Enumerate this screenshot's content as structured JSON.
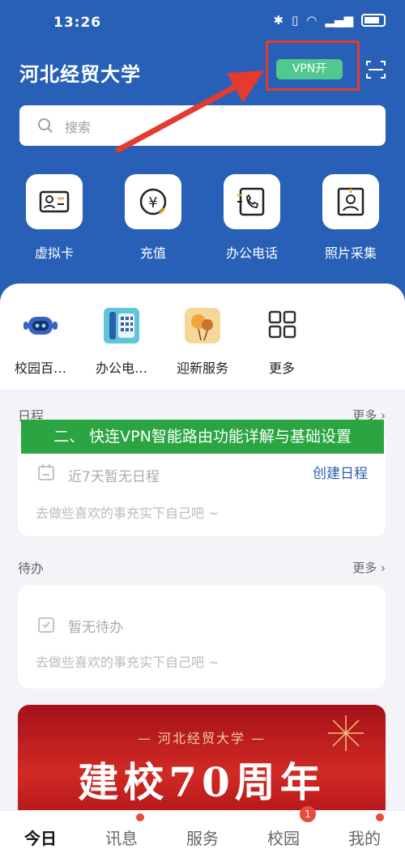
{
  "status_bar": {
    "time": "13:26"
  },
  "header": {
    "title": "河北经贸大学",
    "vpn_label": "VPN开",
    "vpn_color": "#4fc98d",
    "scan_icon": "scan-icon"
  },
  "search": {
    "placeholder": "搜索"
  },
  "quick_actions": [
    {
      "label": "虚拟卡",
      "icon": "id-card-icon"
    },
    {
      "label": "充值",
      "icon": "yen-icon"
    },
    {
      "label": "办公电话",
      "icon": "phone-icon"
    },
    {
      "label": "照片采集",
      "icon": "portrait-icon"
    }
  ],
  "services": [
    {
      "label": "校园百…",
      "icon": "robot-icon"
    },
    {
      "label": "办公电…",
      "icon": "telephone-icon"
    },
    {
      "label": "迎新服务",
      "icon": "balloon-icon"
    },
    {
      "label": "更多",
      "icon": "grid-icon"
    }
  ],
  "schedule": {
    "title": "日程",
    "more": "更多",
    "empty": "近7天暂无日程",
    "tip": "去做些喜欢的事充实下自己吧 ~",
    "create": "创建日程"
  },
  "todo": {
    "title": "待办",
    "more": "更多",
    "empty": "暂无待办",
    "tip": "去做些喜欢的事充实下自己吧 ~"
  },
  "overlay_banner": "二、 快连VPN智能路由功能详解与基础设置",
  "promo": {
    "small": "— 河北经贸大学 —",
    "big": "建校70周年"
  },
  "tabs": [
    {
      "label": "今日",
      "active": true
    },
    {
      "label": "讯息"
    },
    {
      "label": "服务"
    },
    {
      "label": "校园",
      "badge": "1"
    },
    {
      "label": "我的"
    }
  ]
}
